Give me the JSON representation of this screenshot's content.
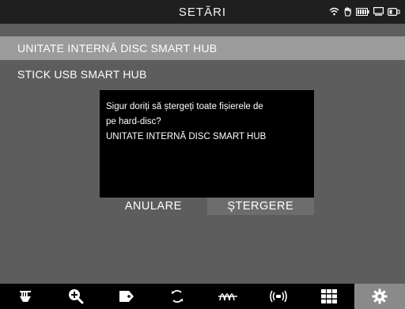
{
  "header": {
    "title": "SETĂRI",
    "status_icons": [
      "wifi-icon",
      "hand-icon",
      "battery-icon",
      "display-icon",
      "connector-icon"
    ]
  },
  "menu": {
    "items": [
      {
        "label": "UNITATE INTERNĂ DISC SMART HUB",
        "selected": true
      },
      {
        "label": "STICK USB SMART HUB",
        "selected": false
      }
    ]
  },
  "dialog": {
    "line1": "Sigur doriți să ștergeți toate fișierele de",
    "line2": "pe hard-disc?",
    "line3": "UNITATE INTERNĂ DISC SMART HUB",
    "cancel_label": "ANULARE",
    "delete_label": "ŞTERGERE"
  },
  "toolbar": {
    "tools": [
      "illuminator-icon",
      "zoom-in-icon",
      "tag-icon",
      "rotate-icon",
      "waveform-icon",
      "broadcast-icon",
      "grid-icon",
      "settings-gear-icon"
    ],
    "active": "settings-gear-icon"
  },
  "colors": {
    "background": "#5d5d5d",
    "header": "#1f1f1f",
    "selected_row": "#9b9b9b",
    "dialog": "#000000",
    "delete_button": "#6d6d6d",
    "toolbar": "#000000",
    "toolbar_active": "#8a8a8a"
  }
}
